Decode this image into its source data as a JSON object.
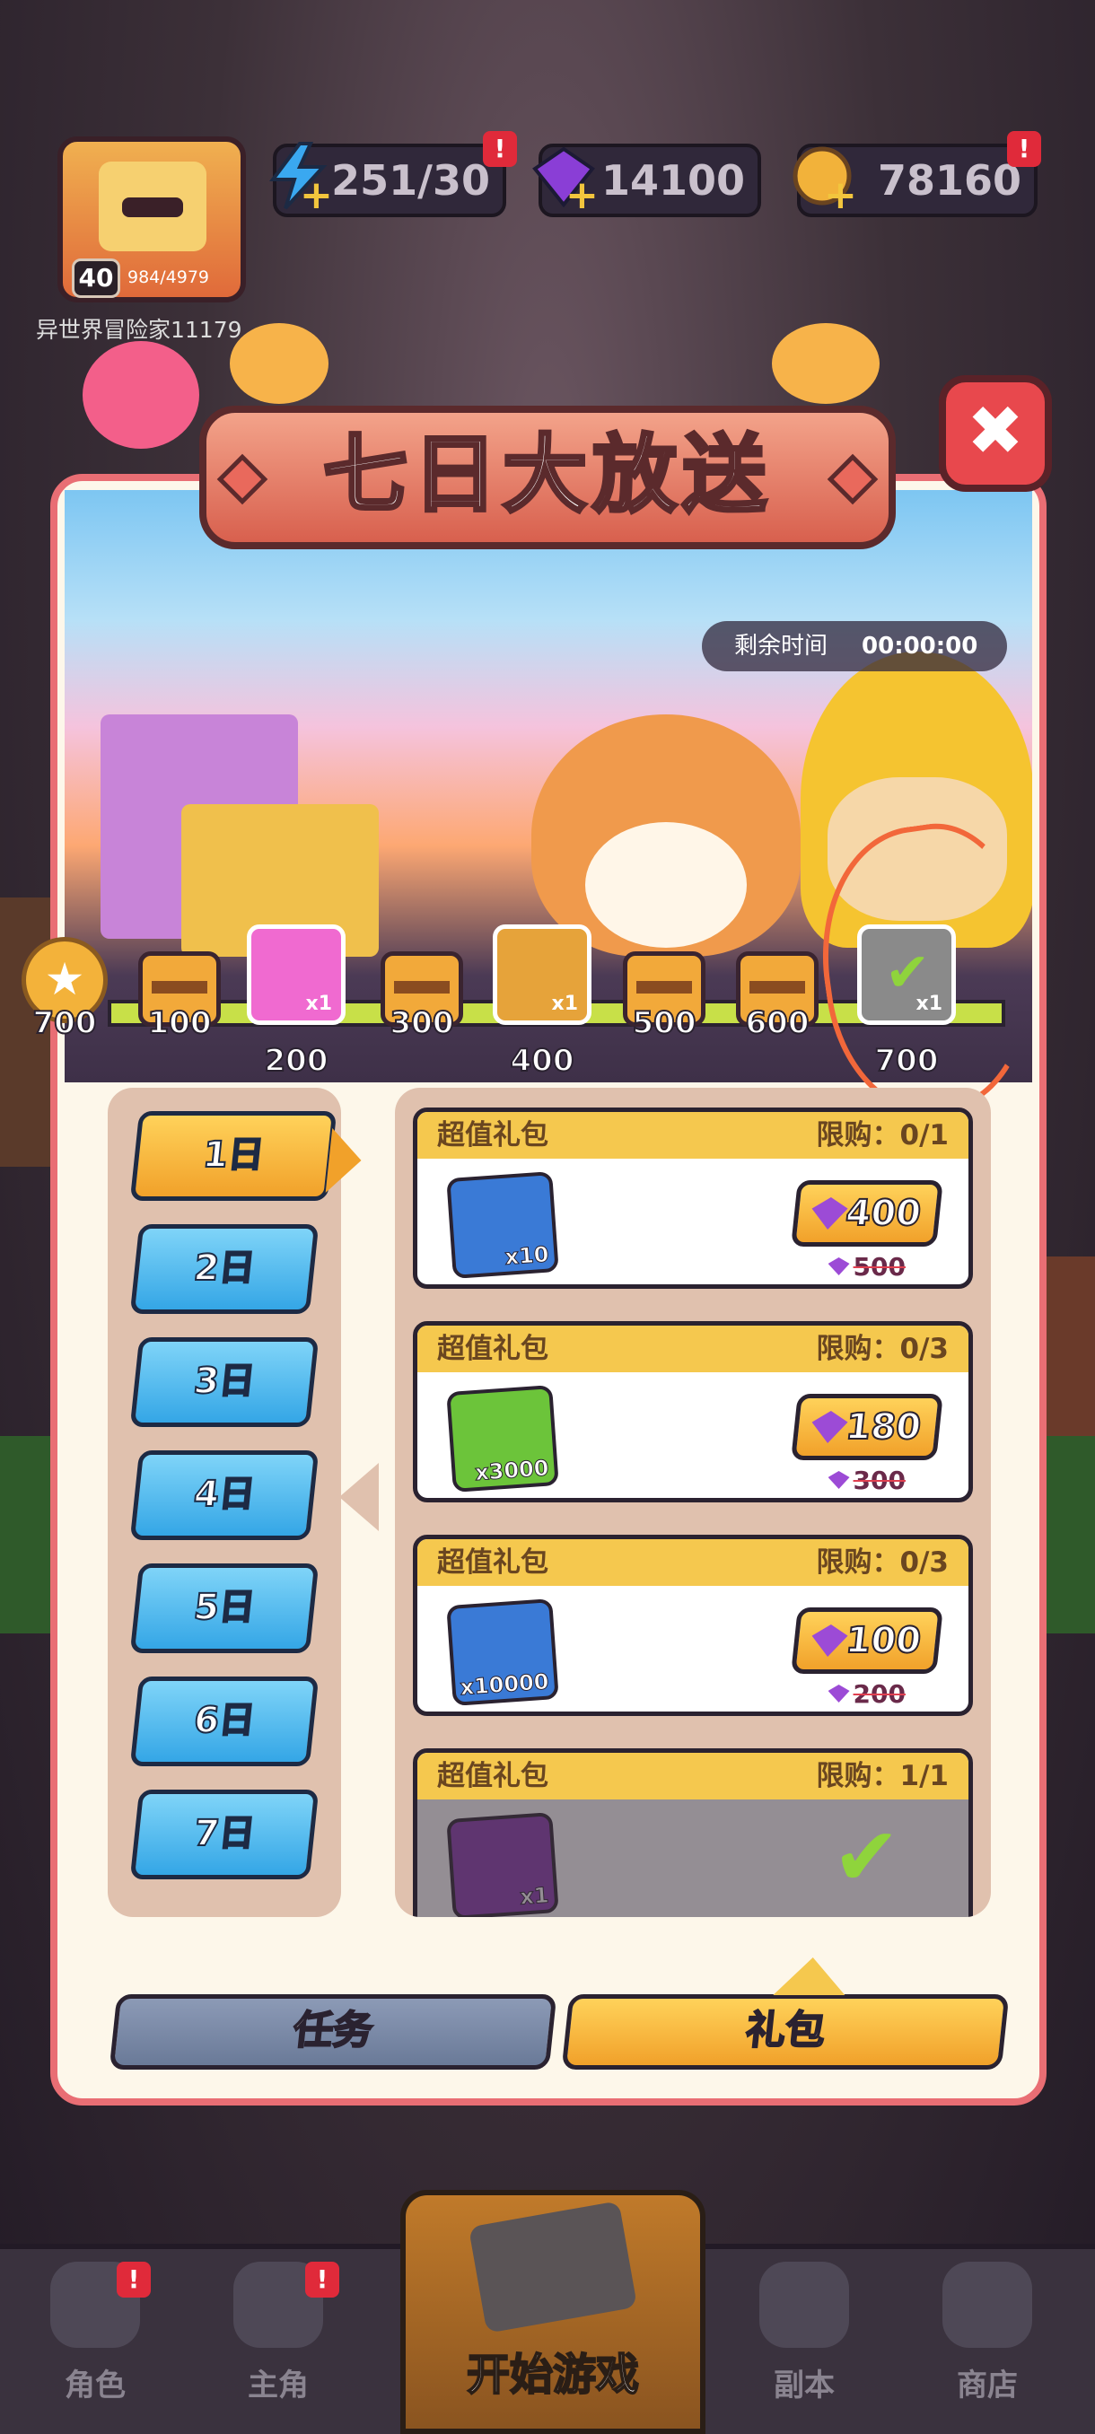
{
  "hud": {
    "level": "40",
    "exp": "984/4979",
    "player_name": "异世界冒险家11179",
    "energy": "251/30",
    "gems": "14100",
    "coins": "78160",
    "alert_mark": "!"
  },
  "modal": {
    "title": "七日大放送",
    "close_icon": "✖",
    "timer_label": "剩余时间",
    "timer_value": "00:00:00"
  },
  "rewards": [
    {
      "value": "700",
      "type": "medal"
    },
    {
      "value": "100",
      "type": "chest"
    },
    {
      "value": "200",
      "type": "character",
      "mult": "x1"
    },
    {
      "value": "300",
      "type": "chest"
    },
    {
      "value": "400",
      "type": "character",
      "mult": "x1"
    },
    {
      "value": "500",
      "type": "chest"
    },
    {
      "value": "600",
      "type": "chest"
    },
    {
      "value": "700",
      "type": "character",
      "mult": "x1",
      "claimed": true
    }
  ],
  "days": [
    "1日",
    "2日",
    "3日",
    "4日",
    "5日",
    "6日",
    "7日"
  ],
  "packages": [
    {
      "title": "超值礼包",
      "limit": "限购：0/1",
      "qty": "x10",
      "price": "400",
      "old_price": "500",
      "item_color": "#3a7ad6"
    },
    {
      "title": "超值礼包",
      "limit": "限购：0/3",
      "qty": "x3000",
      "price": "180",
      "old_price": "300",
      "item_color": "#6cc43a"
    },
    {
      "title": "超值礼包",
      "limit": "限购：0/3",
      "qty": "x10000",
      "price": "100",
      "old_price": "200",
      "item_color": "#3a7ad6"
    },
    {
      "title": "超值礼包",
      "limit": "限购：1/1",
      "qty": "x1",
      "item_color": "#8a3ab0",
      "purchased": true
    }
  ],
  "bottom_tabs": {
    "tasks": "任务",
    "gifts": "礼包"
  },
  "nav": {
    "character": "角色",
    "hero": "主角",
    "start": "开始游戏",
    "dungeon": "副本",
    "shop": "商店"
  },
  "colors": {
    "accent": "#f1a12a",
    "modal_border": "#e96e74",
    "day_tab": "#34a6e6",
    "annotation_circle": "#f2673a"
  }
}
